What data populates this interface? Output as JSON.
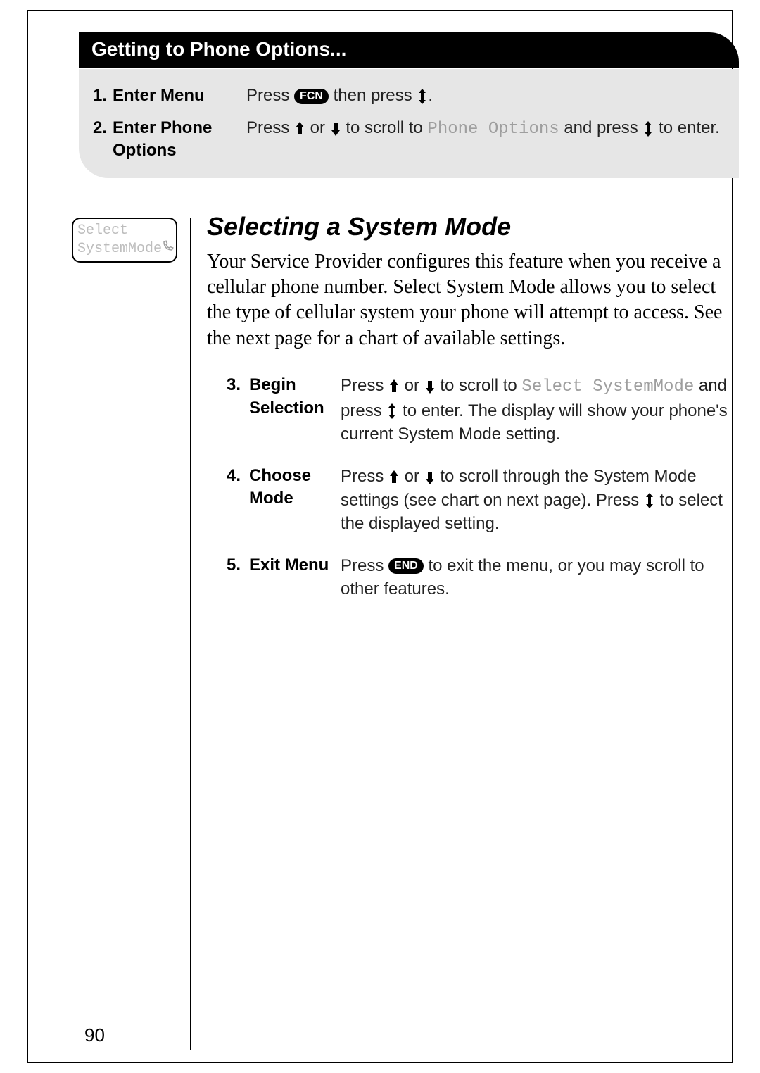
{
  "header": "Getting to Phone Options...",
  "intro": [
    {
      "num": "1.",
      "label": "Enter Menu",
      "desc": [
        {
          "t": "txt",
          "v": "Press "
        },
        {
          "t": "fcn"
        },
        {
          "t": "txt",
          "v": " then press "
        },
        {
          "t": "updown"
        },
        {
          "t": "txt",
          "v": "."
        }
      ]
    },
    {
      "num": "2.",
      "label": "Enter Phone Options",
      "desc": [
        {
          "t": "txt",
          "v": "Press "
        },
        {
          "t": "up"
        },
        {
          "t": "txt",
          "v": " or "
        },
        {
          "t": "down"
        },
        {
          "t": "txt",
          "v": " to scroll to "
        },
        {
          "t": "lcd",
          "v": "Phone Options"
        },
        {
          "t": "txt",
          "v": " and press "
        },
        {
          "t": "updown"
        },
        {
          "t": "txt",
          "v": " to enter."
        }
      ]
    }
  ],
  "card": {
    "line1": "Select",
    "line2": "SystemMode"
  },
  "section_title": "Selecting a System Mode",
  "section_para": "Your Service Provider configures this feature when you receive a cellular phone number. Select System Mode allows you to select the type of cellular system your phone will attempt to access. See the next page for a chart of available settings.",
  "steps": [
    {
      "num": "3.",
      "label": "Begin Selection",
      "desc": [
        {
          "t": "txt",
          "v": "Press "
        },
        {
          "t": "up"
        },
        {
          "t": "txt",
          "v": " or "
        },
        {
          "t": "down"
        },
        {
          "t": "txt",
          "v": " to scroll to "
        },
        {
          "t": "lcd",
          "v": "Select SystemMode"
        },
        {
          "t": "txt",
          "v": " and press "
        },
        {
          "t": "updown"
        },
        {
          "t": "txt",
          "v": " to enter. The display will show your phone's current System Mode setting."
        }
      ]
    },
    {
      "num": "4.",
      "label": "Choose Mode",
      "desc": [
        {
          "t": "txt",
          "v": "Press "
        },
        {
          "t": "up"
        },
        {
          "t": "txt",
          "v": " or "
        },
        {
          "t": "down"
        },
        {
          "t": "txt",
          "v": " to scroll through the System Mode settings (see chart on next page). Press "
        },
        {
          "t": "updown"
        },
        {
          "t": "txt",
          "v": " to select the displayed setting."
        }
      ]
    },
    {
      "num": "5.",
      "label": "Exit Menu",
      "desc": [
        {
          "t": "txt",
          "v": "Press "
        },
        {
          "t": "end"
        },
        {
          "t": "txt",
          "v": " to exit the menu, or you may scroll to other features."
        }
      ]
    }
  ],
  "labels": {
    "fcn": "FCN",
    "end": "END"
  },
  "page_number": "90"
}
